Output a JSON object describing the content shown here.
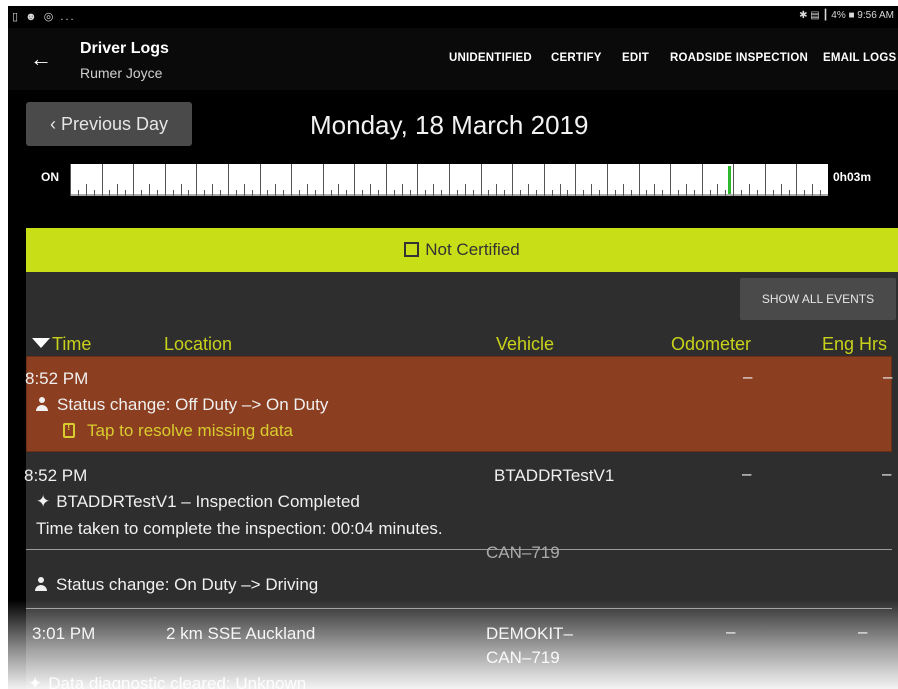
{
  "status_bar": {
    "left": "▯ ☻ ◎ ...",
    "right": "✱ ▤ ┃ 4% ■ 9:56 AM"
  },
  "app_bar": {
    "title": "Driver Logs",
    "subtitle": "Rumer Joyce",
    "back_icon": "arrow-left-icon",
    "actions": [
      "UNIDENTIFIED",
      "CERTIFY",
      "EDIT",
      "ROADSIDE INSPECTION",
      "EMAIL LOGS"
    ]
  },
  "date_nav": {
    "previous_label": "‹ Previous Day",
    "date": "Monday, 18 March 2019"
  },
  "timeline": {
    "status_label": "ON",
    "duration": "0h03m",
    "activity_marker_color": "#2eb82e"
  },
  "certification": {
    "label": "Not Certified",
    "color": "#c8de17"
  },
  "events": {
    "show_all_label": "SHOW ALL EVENTS",
    "columns": [
      "Time",
      "Location",
      "Vehicle",
      "Odometer",
      "Eng Hrs"
    ],
    "rows": [
      {
        "time": "8:52 PM",
        "odometer": "–",
        "eng_hrs": "–",
        "event": "Status change: Off Duty –> On Duty",
        "action": "Tap to resolve missing data",
        "highlight_color": "#8b3e20"
      },
      {
        "time": "8:52 PM",
        "vehicle": "BTADDRTestV1",
        "odometer": "–",
        "eng_hrs": "–",
        "event": "BTADDRTestV1 – Inspection Completed",
        "detail": "Time taken to complete the inspection: 00:04 minutes."
      },
      {
        "vehicle": "CAN–719",
        "event": "Status change: On Duty –> Driving"
      },
      {
        "time": "3:01 PM",
        "location": "2 km SSE Auckland",
        "vehicle_line1": "DEMOKIT–",
        "vehicle_line2": "CAN–719",
        "odometer": "–",
        "eng_hrs": "–",
        "event": "Data diagnostic cleared: Unknown"
      }
    ]
  }
}
